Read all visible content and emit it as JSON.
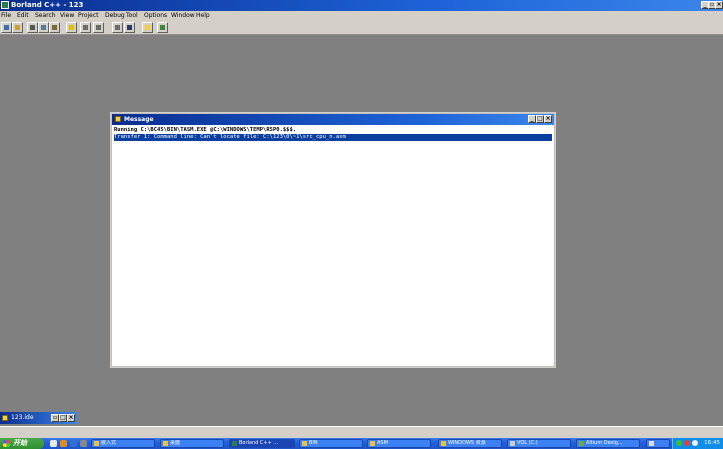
{
  "window": {
    "title": "Borland C++ - 123"
  },
  "menu": [
    "File",
    "Edit",
    "Search",
    "View",
    "Project",
    "Debug",
    "Tool",
    "Options",
    "Window",
    "Help"
  ],
  "toolbar": {
    "button_count": 12
  },
  "message_window": {
    "title": "Message",
    "lines": [
      "Running C:\\BC45\\BIN\\TASM.EXE @C:\\WINDOWS\\TEMP\\R5P0.$$$.",
      "Transfer 1: Command line: Can't locate file: C:\\123\\0\\~1\\src_cpu_n.asm"
    ]
  },
  "minimized_window": {
    "title": "123.ide"
  },
  "taskbar": {
    "start_label": "开始",
    "tasks": [
      "嵌入式",
      "桌面",
      "Borland C++ ...",
      "BIN",
      "ASM",
      "WINDOWS 资源",
      "VOL (C:)",
      "Altium Desig...",
      ""
    ],
    "clock": "16:45"
  },
  "colors": {
    "title_bar": "#1d63d8",
    "desktop": "#808080",
    "selection": "#0a3f9f"
  }
}
